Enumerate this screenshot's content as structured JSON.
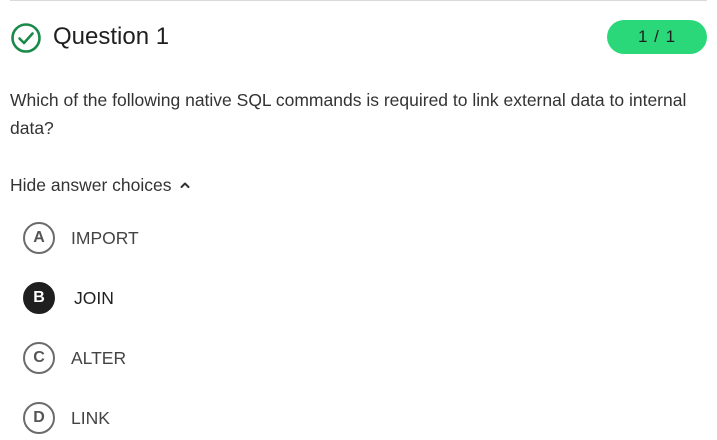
{
  "question": {
    "status_icon": "check-circle-icon",
    "title": "Question 1",
    "score": "1 / 1",
    "prompt": "Which of the following native SQL commands is required to link external data to internal data?",
    "toggle_label": "Hide answer choices",
    "toggle_icon": "chevron-up-icon",
    "choices": [
      {
        "letter": "A",
        "text": "IMPORT",
        "selected": false
      },
      {
        "letter": "B",
        "text": "JOIN",
        "selected": true
      },
      {
        "letter": "C",
        "text": "ALTER",
        "selected": false
      },
      {
        "letter": "D",
        "text": "LINK",
        "selected": false
      }
    ]
  },
  "colors": {
    "correct_green": "#1a8a4a",
    "badge_green": "#2bd879",
    "selected_fill": "#1f1f1f"
  }
}
